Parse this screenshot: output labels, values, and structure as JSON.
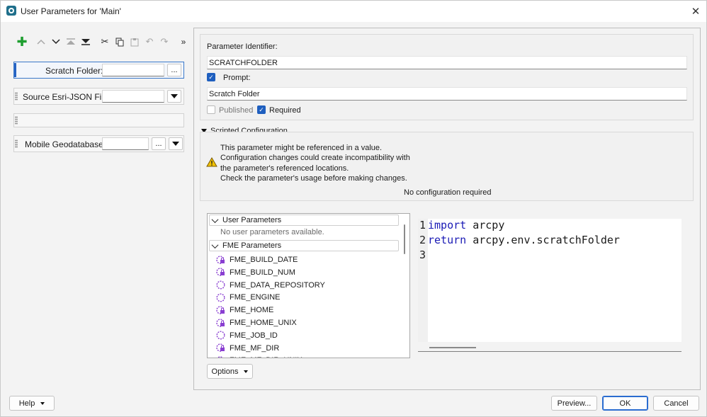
{
  "window": {
    "title": "User Parameters for 'Main'"
  },
  "toolbar": {
    "buttons": [
      {
        "name": "add-parameter-button",
        "glyph": "+",
        "enabled": true
      },
      {
        "name": "move-up-button",
        "glyph": "∧",
        "enabled": false
      },
      {
        "name": "move-down-button",
        "glyph": "∨",
        "enabled": true
      },
      {
        "name": "move-to-top-button",
        "glyph": "⤒",
        "enabled": false
      },
      {
        "name": "move-to-bottom-button",
        "glyph": "⤓",
        "enabled": true
      },
      {
        "name": "cut-button",
        "glyph": "✂",
        "enabled": true
      },
      {
        "name": "copy-button",
        "glyph": "⧉",
        "enabled": true
      },
      {
        "name": "paste-button",
        "glyph": "📋",
        "enabled": false
      },
      {
        "name": "undo-button",
        "glyph": "↶",
        "enabled": false
      },
      {
        "name": "redo-button",
        "glyph": "↷",
        "enabled": false
      },
      {
        "name": "more-button",
        "glyph": "»",
        "enabled": true
      }
    ]
  },
  "parameters": [
    {
      "label": "Scratch Folder:",
      "required_mark": "*",
      "browse_label": "...",
      "selected": true
    },
    {
      "label": "Source Esri-JSON File:",
      "required_mark": "*",
      "selected": false
    },
    {
      "label": "",
      "selected": false
    },
    {
      "label": "Mobile Geodatabase:",
      "required_mark": "*",
      "browse_label": "...",
      "selected": false
    }
  ],
  "properties": {
    "identifier_label": "Parameter Identifier:",
    "identifier_value": "SCRATCHFOLDER",
    "prompt_label": "Prompt:",
    "prompt_checked": true,
    "prompt_value": "Scratch Folder",
    "published_label": "Published",
    "published_checked": false,
    "required_label": "Required",
    "required_checked": true
  },
  "scripted": {
    "section_title": "Scripted Configuration",
    "warning_lines": [
      "This parameter might be referenced in a value.",
      "Configuration changes could create incompatibility with",
      "the parameter's referenced locations.",
      "Check the parameter's usage before making changes."
    ],
    "status": "No configuration required"
  },
  "tree": {
    "user_header": "User Parameters",
    "user_empty": "No user parameters available.",
    "fme_header": "FME Parameters",
    "fme_items": [
      {
        "name": "FME_BUILD_DATE",
        "locked": true
      },
      {
        "name": "FME_BUILD_NUM",
        "locked": true
      },
      {
        "name": "FME_DATA_REPOSITORY",
        "locked": false
      },
      {
        "name": "FME_ENGINE",
        "locked": false
      },
      {
        "name": "FME_HOME",
        "locked": true
      },
      {
        "name": "FME_HOME_UNIX",
        "locked": true
      },
      {
        "name": "FME_JOB_ID",
        "locked": false
      },
      {
        "name": "FME_MF_DIR",
        "locked": true
      },
      {
        "name": "FME_MF_DIR_UNIX",
        "locked": true
      }
    ]
  },
  "code": {
    "lines": [
      {
        "num": "1",
        "keyword": "import",
        "rest": " arcpy"
      },
      {
        "num": "2",
        "keyword": "return",
        "rest": " arcpy.env.scratchFolder"
      },
      {
        "num": "3",
        "keyword": "",
        "rest": ""
      }
    ]
  },
  "buttons": {
    "options": "Options",
    "help": "Help",
    "preview": "Preview...",
    "ok": "OK",
    "cancel": "Cancel"
  },
  "colors": {
    "accent": "#1f5fbf",
    "keyword": "#1a1ab5",
    "lock_icon": "#8a3fd1",
    "required_star": "#dd2222",
    "warning": "#f2c200"
  }
}
